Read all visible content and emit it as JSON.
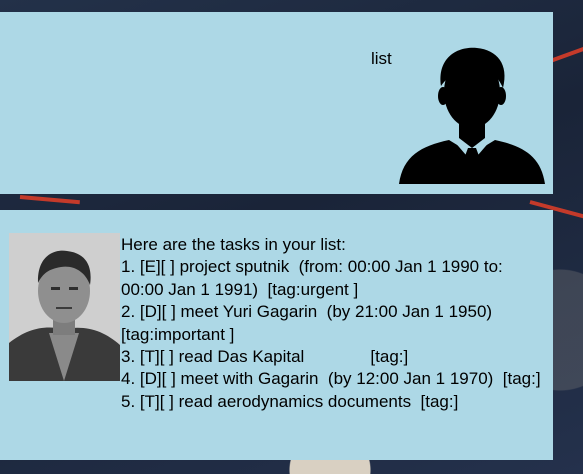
{
  "user_message": {
    "text": "list"
  },
  "bot_message": {
    "lines": [
      "Here are the tasks in your list:",
      "1. [E][ ] project sputnik  (from: 00:00 Jan 1 1990 to: 00:00 Jan 1 1991)  [tag:urgent ]",
      "2. [D][ ] meet Yuri Gagarin  (by 21:00 Jan 1 1950) [tag:important ]",
      "3. [T][ ] read Das Kapital              [tag:]",
      "4. [D][ ] meet with Gagarin  (by 12:00 Jan 1 1970)  [tag:]",
      "5. [T][ ] read aerodynamics documents  [tag:]"
    ]
  },
  "colors": {
    "bubble": "#add8e6",
    "text": "#000000"
  },
  "icons": {
    "user_avatar": "user-silhouette-icon",
    "bot_avatar": "bot-portrait-photo"
  }
}
